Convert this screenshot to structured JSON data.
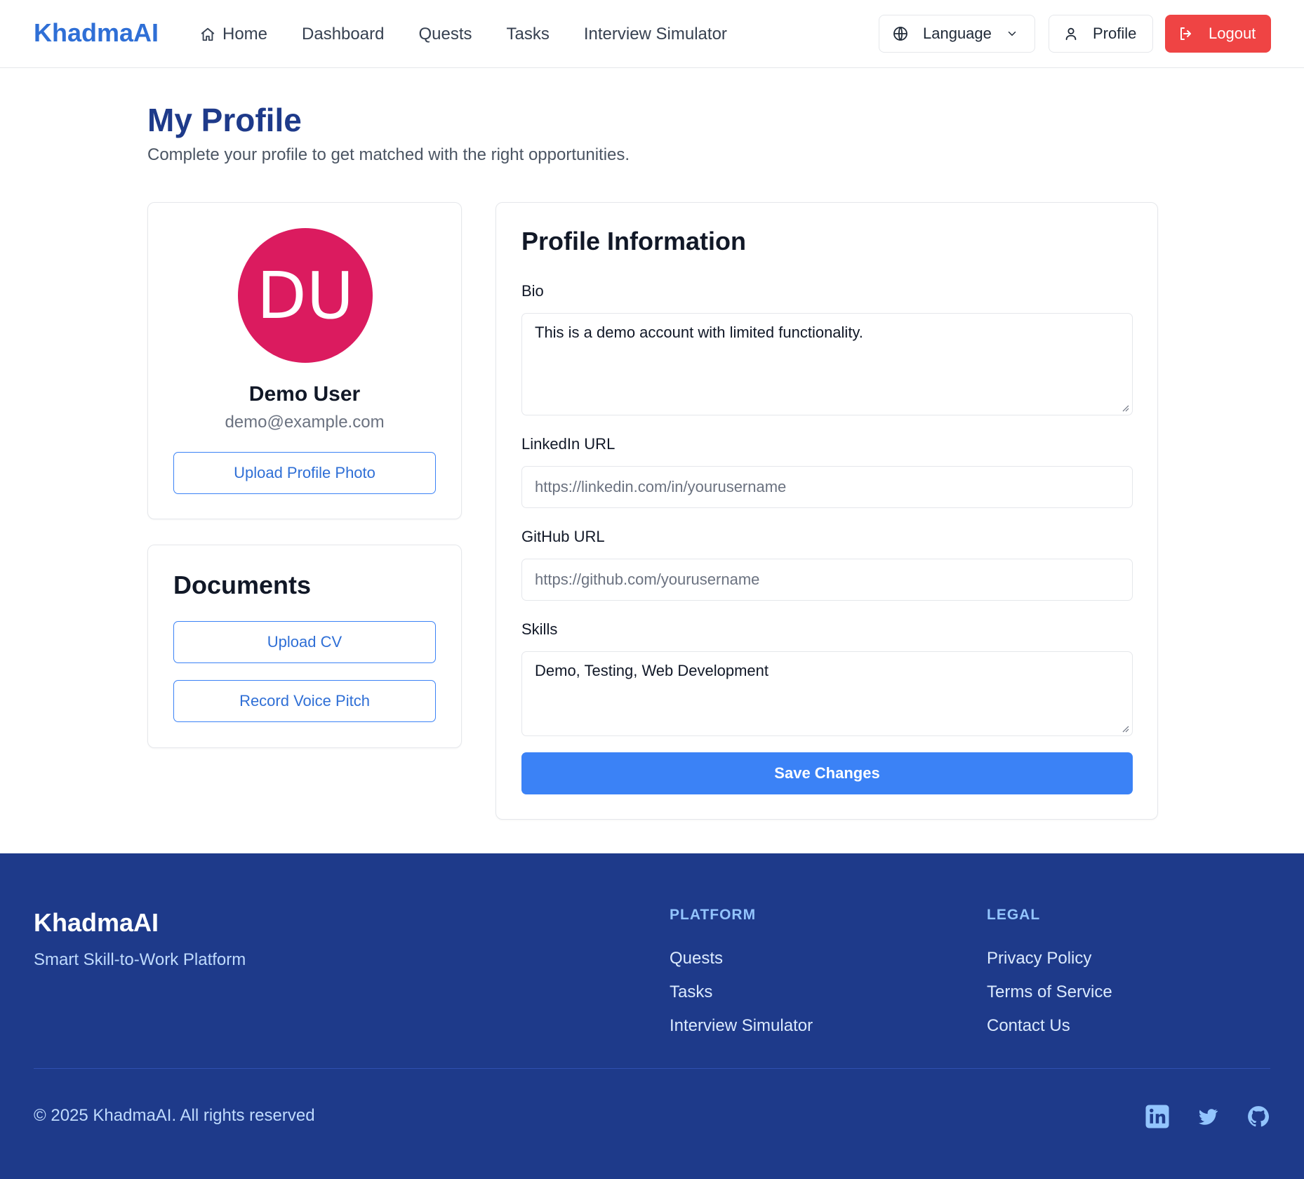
{
  "header": {
    "logo": "KhadmaAI",
    "nav": [
      {
        "label": "Home",
        "icon": "home-icon"
      },
      {
        "label": "Dashboard"
      },
      {
        "label": "Quests"
      },
      {
        "label": "Tasks"
      },
      {
        "label": "Interview Simulator"
      }
    ],
    "language_label": "Language",
    "profile_label": "Profile",
    "logout_label": "Logout"
  },
  "page": {
    "title": "My Profile",
    "subtitle": "Complete your profile to get matched with the right opportunities."
  },
  "user": {
    "initials": "DU",
    "name": "Demo User",
    "email": "demo@example.com",
    "upload_photo_label": "Upload Profile Photo"
  },
  "documents": {
    "title": "Documents",
    "upload_cv_label": "Upload CV",
    "record_pitch_label": "Record Voice Pitch"
  },
  "profile_info": {
    "title": "Profile Information",
    "bio_label": "Bio",
    "bio_value": "This is a demo account with limited functionality.",
    "linkedin_label": "LinkedIn URL",
    "linkedin_placeholder": "https://linkedin.com/in/yourusername",
    "github_label": "GitHub URL",
    "github_placeholder": "https://github.com/yourusername",
    "skills_label": "Skills",
    "skills_value": "Demo, Testing, Web Development",
    "save_label": "Save Changes"
  },
  "footer": {
    "brand": "KhadmaAI",
    "tagline": "Smart Skill-to-Work Platform",
    "platform_heading": "PLATFORM",
    "platform_links": [
      "Quests",
      "Tasks",
      "Interview Simulator"
    ],
    "legal_heading": "LEGAL",
    "legal_links": [
      "Privacy Policy",
      "Terms of Service",
      "Contact Us"
    ],
    "copyright": "© 2025 KhadmaAI. All rights reserved",
    "social_icons": [
      "linkedin-icon",
      "twitter-icon",
      "github-icon"
    ]
  },
  "colors": {
    "brand_blue": "#2f6fd6",
    "primary_button": "#3b82f6",
    "logout_red": "#ef4444",
    "avatar_bg": "#db1b5f",
    "footer_bg": "#1e3a8a"
  }
}
